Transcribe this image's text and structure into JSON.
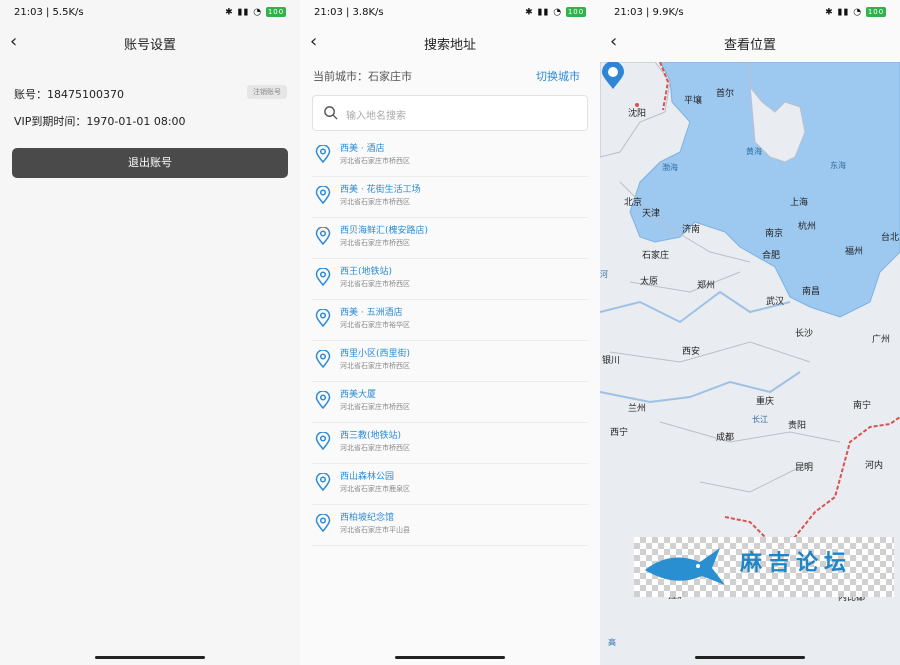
{
  "status": [
    {
      "time": "21:03 | 5.5K/s",
      "battery": "100"
    },
    {
      "time": "21:03 | 3.8K/s",
      "battery": "100"
    },
    {
      "time": "21:03 | 9.9K/s",
      "battery": "100"
    }
  ],
  "account": {
    "title": "账号设置",
    "account_line": "账号：18475100370",
    "cancel_label": "注销账号",
    "vip_line": "VIP到期时间：1970-01-01 08:00",
    "logout_label": "退出账号"
  },
  "search": {
    "title": "搜索地址",
    "current_city": "当前城市：石家庄市",
    "switch_city": "切换城市",
    "placeholder": "输入地名搜索",
    "results": [
      {
        "name": "西美 · 酒店",
        "addr": "河北省石家庄市桥西区"
      },
      {
        "name": "西美 · 花街生活工场",
        "addr": "河北省石家庄市桥西区"
      },
      {
        "name": "西贝海鲜汇(槐安路店)",
        "addr": "河北省石家庄市桥西区"
      },
      {
        "name": "西王(地铁站)",
        "addr": "河北省石家庄市桥西区"
      },
      {
        "name": "西美 · 五洲酒店",
        "addr": "河北省石家庄市裕华区"
      },
      {
        "name": "西里小区(西里街)",
        "addr": "河北省石家庄市桥西区"
      },
      {
        "name": "西美大厦",
        "addr": "河北省石家庄市桥西区"
      },
      {
        "name": "西三教(地铁站)",
        "addr": "河北省石家庄市桥西区"
      },
      {
        "name": "西山森林公园",
        "addr": "河北省石家庄市鹿泉区"
      },
      {
        "name": "西柏坡纪念馆",
        "addr": "河北省石家庄市平山县"
      }
    ]
  },
  "map": {
    "title": "查看位置",
    "cities": [
      "沈阳",
      "平壤",
      "首尔",
      "北京",
      "天津",
      "济南",
      "石家庄",
      "上海",
      "南京",
      "杭州",
      "合肥",
      "福州",
      "台北",
      "太原",
      "郑州",
      "武汉",
      "南昌",
      "长沙",
      "广州",
      "西安",
      "银川",
      "兰州",
      "西宁",
      "重庆",
      "成都",
      "贵阳",
      "南宁",
      "昆明",
      "河内",
      "拉萨",
      "内比都"
    ],
    "seas": [
      "渤海",
      "黄海",
      "东海"
    ],
    "rivers": [
      "长江",
      "河"
    ],
    "watermark": "麻吉论坛",
    "logo": "高"
  }
}
